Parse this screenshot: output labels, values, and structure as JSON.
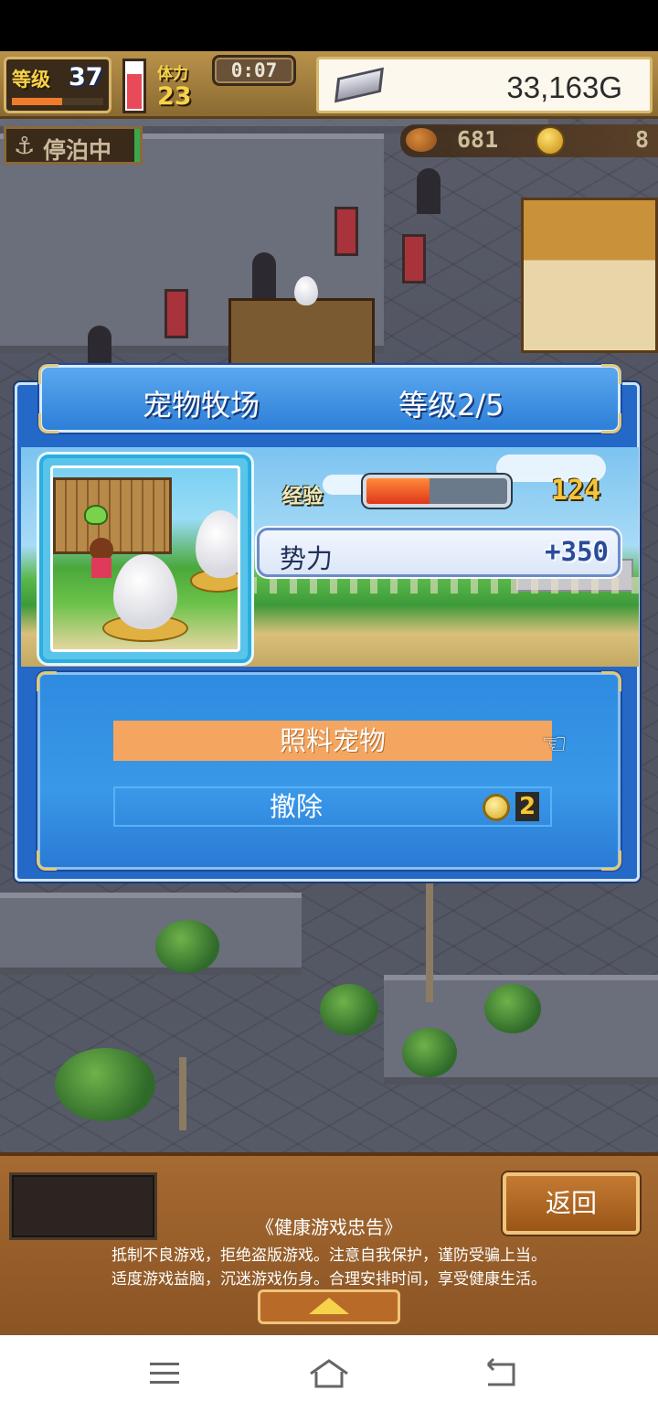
{
  "hud": {
    "level_label": "等级",
    "level_value": "37",
    "level_progress": 0.55,
    "stamina_label": "体力",
    "stamina_value": "23",
    "stamina_fill": 0.7,
    "timer": "0:07",
    "money": "33,163G",
    "mooring_status": "停泊中",
    "food_value": "681",
    "medal_value": "8",
    "icons": [
      "level-icon",
      "anchor-icon",
      "food-icon",
      "coin-icon",
      "silver-bar-icon"
    ]
  },
  "dialog": {
    "facility_name": "宠物牧场",
    "facility_level": "等级2/5",
    "exp_label": "经验",
    "exp_progress": 0.45,
    "exp_value": "124",
    "power_label": "势力",
    "power_value": "+350",
    "menu": {
      "feed_label": "照料宠物",
      "remove_label": "撤除",
      "remove_cost": "2"
    }
  },
  "bottom": {
    "back_label": "返回",
    "health_title": "《健康游戏忠告》",
    "health_line1": "抵制不良游戏，拒绝盗版游戏。注意自我保护，谨防受骗上当。",
    "health_line2": "适度游戏益脑，沉迷游戏伤身。合理安排时间，享受健康生活。"
  },
  "colors": {
    "dialog_blue": "#2468c8",
    "feed_highlight": "#f4a660",
    "exp_fill": "#e0361a",
    "money_text": "#2b2b2b",
    "bottom_wood": "#a66a32"
  }
}
